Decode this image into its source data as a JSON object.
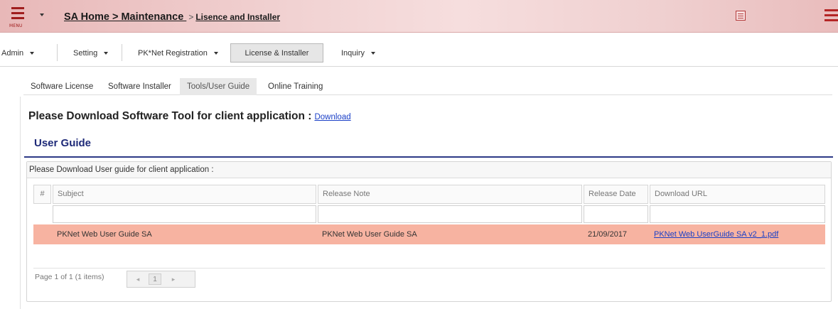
{
  "header": {
    "menu_caption": "MENU",
    "breadcrumb": {
      "home": "SA Home > Maintenance ",
      "separator": ">",
      "current": "Lisence and Installer"
    }
  },
  "mainnav": {
    "items": [
      {
        "label": "Admin",
        "dropdown": true
      },
      {
        "label": "Setting",
        "dropdown": true
      },
      {
        "label": "PK*Net Registration",
        "dropdown": true
      },
      {
        "label": "License & Installer",
        "dropdown": false,
        "active": true
      },
      {
        "label": "Inquiry",
        "dropdown": true
      }
    ]
  },
  "subtabs": [
    {
      "label": "Software License"
    },
    {
      "label": "Software Installer"
    },
    {
      "label": "Tools/User Guide",
      "active": true
    },
    {
      "label": "Online Training"
    }
  ],
  "content": {
    "download_text": "Please Download Software Tool for client application :",
    "download_link": "Download",
    "user_guide_heading": "User Guide",
    "grid_caption": "Please Download User guide for client application :"
  },
  "table": {
    "columns": [
      "#",
      "Subject",
      "Release Note",
      "Release Date",
      "Download URL"
    ],
    "rows": [
      {
        "subject": "PKNet Web User Guide SA",
        "release_note": "PKNet Web User Guide SA",
        "release_date": "21/09/2017",
        "download_url": "PKNet Web UserGuide SA v2_1.pdf"
      }
    ]
  },
  "pager": {
    "info": "Page 1 of 1 (1 items)",
    "current_page": "1",
    "prev": "◂",
    "next": "▸"
  },
  "colors": {
    "header_gradient": "#e8b8b8",
    "menu_icon": "#a01e1e",
    "heading_blue": "#1e2a78",
    "row_highlight": "#f7b3a1",
    "link": "#1a3fc7"
  },
  "icons": [
    "hamburger-menu-icon",
    "chevron-down-icon",
    "card-icon",
    "hamburger-icon"
  ]
}
